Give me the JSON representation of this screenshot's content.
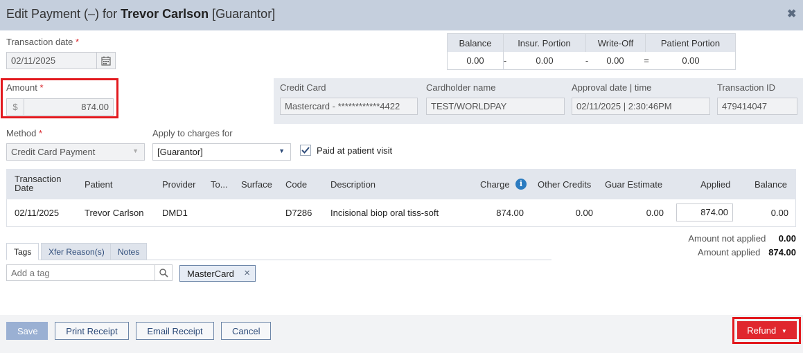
{
  "dialog": {
    "title_prefix": "Edit Payment (–) for",
    "title_name": "Trevor Carlson",
    "title_role": "[Guarantor]"
  },
  "transaction_date": {
    "label": "Transaction date",
    "required_mark": "*",
    "value": "02/11/2025"
  },
  "summary": {
    "headers": [
      "Balance",
      "Insur. Portion",
      "Write-Off",
      "Patient Portion"
    ],
    "values": [
      "0.00",
      "0.00",
      "0.00",
      "0.00"
    ],
    "ops": [
      "-",
      "-",
      "="
    ]
  },
  "amount": {
    "label": "Amount",
    "required_mark": "*",
    "currency": "$",
    "value": "874.00"
  },
  "card": {
    "credit_card_label": "Credit Card",
    "credit_card_value": "Mastercard - ************4422",
    "cardholder_label": "Cardholder name",
    "cardholder_value": "TEST/WORLDPAY",
    "approval_label": "Approval date | time",
    "approval_value": "02/11/2025 | 2:30:46PM",
    "txn_id_label": "Transaction ID",
    "txn_id_value": "479414047"
  },
  "method": {
    "label": "Method",
    "required_mark": "*",
    "value": "Credit Card Payment"
  },
  "apply_to": {
    "label": "Apply to charges for",
    "value": "[Guarantor]"
  },
  "paid_at_visit": {
    "label": "Paid at patient visit",
    "checked": true
  },
  "grid": {
    "headers": {
      "txn_date_1": "Transaction",
      "txn_date_2": "Date",
      "patient": "Patient",
      "provider": "Provider",
      "tooth": "To...",
      "surface": "Surface",
      "code": "Code",
      "description": "Description",
      "charge": "Charge",
      "other_credits": "Other Credits",
      "guar_estimate": "Guar Estimate",
      "applied": "Applied",
      "balance": "Balance"
    },
    "rows": [
      {
        "txn_date": "02/11/2025",
        "patient": "Trevor Carlson",
        "provider": "DMD1",
        "tooth": "",
        "surface": "",
        "code": "D7286",
        "description": "Incisional biop oral tiss-soft",
        "charge": "874.00",
        "other_credits": "0.00",
        "guar_estimate": "0.00",
        "applied": "874.00",
        "balance": "0.00"
      }
    ]
  },
  "totals": {
    "not_applied_label": "Amount not applied",
    "not_applied_value": "0.00",
    "applied_label": "Amount applied",
    "applied_value": "874.00"
  },
  "tabs": [
    "Tags",
    "Xfer Reason(s)",
    "Notes"
  ],
  "tags": {
    "placeholder": "Add a tag",
    "items": [
      "MasterCard"
    ]
  },
  "footer": {
    "save": "Save",
    "print_receipt": "Print Receipt",
    "email_receipt": "Email Receipt",
    "cancel": "Cancel",
    "refund": "Refund"
  },
  "colors": {
    "header_bg": "#c5cfdd",
    "accent": "#2c4a78",
    "danger": "#e0272e",
    "highlight": "#e2191e"
  }
}
